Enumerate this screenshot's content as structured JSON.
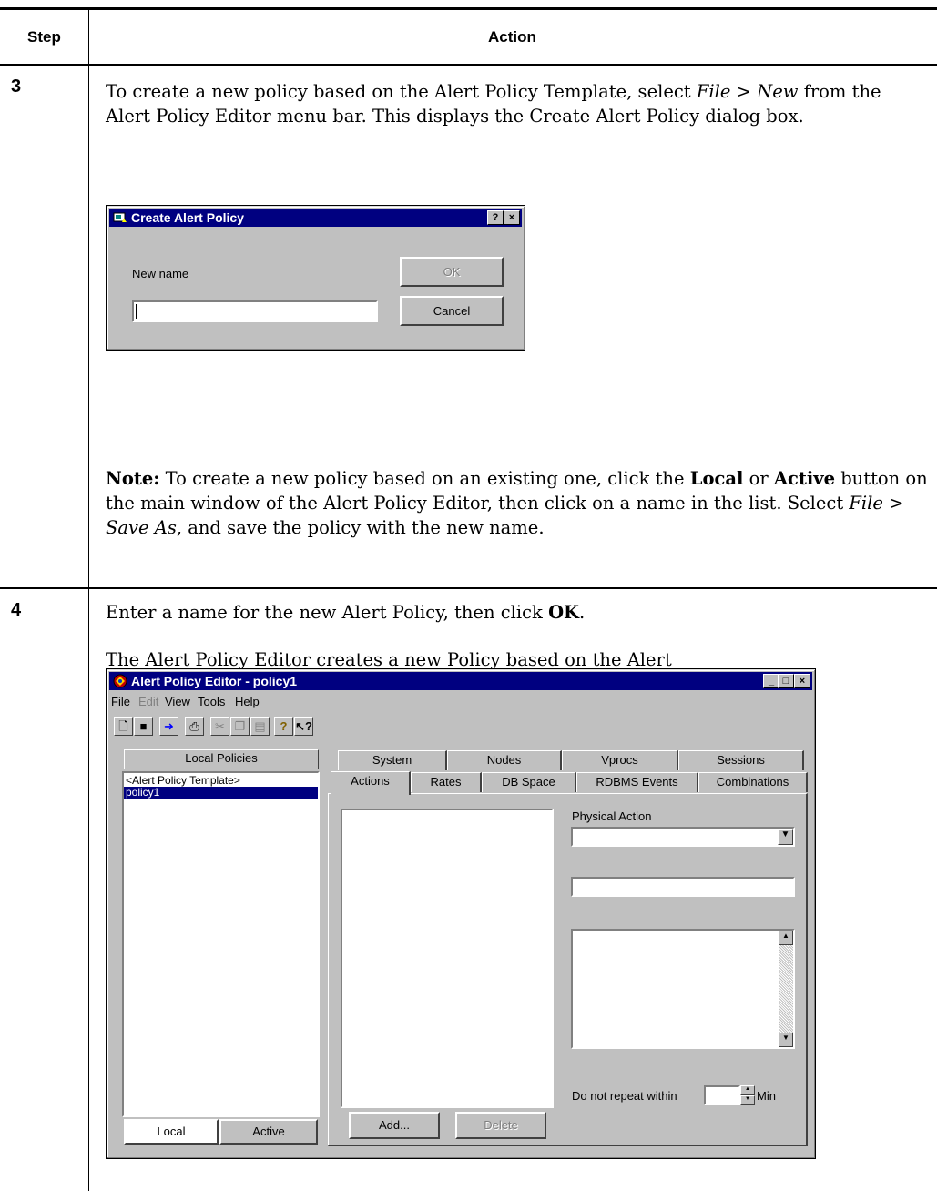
{
  "table": {
    "col_step": "Step",
    "col_action": "Action"
  },
  "step3": {
    "number": "3",
    "intro": "To create a new policy based on the Alert Policy Template, select <i>File</i> &gt; <i>New</i> from the Alert Policy Editor menu bar. This displays the Create Alert Policy dialog box.",
    "note": "<b>Note:</b> To create a new policy based on an existing one, click the <b>Local</b> or <b>Active</b> button on the main window of the Alert Policy Editor, then click on a name in the list. Select <i>File</i> &gt; <i>Save As</i>, and save the policy with the new name.",
    "dialog": {
      "title": "Create Alert Policy",
      "help_btn": "?",
      "close_btn": "×",
      "new_name_label": "New name",
      "new_name_value": "",
      "ok_label": "OK",
      "cancel_label": "Cancel"
    }
  },
  "step4": {
    "number": "4",
    "line1": "Enter a name for the new Alert Policy, then click <b>OK</b>.",
    "line2": "The Alert Policy Editor creates a new Policy based on the Alert Policy Template.",
    "editor": {
      "title": "Alert Policy Editor - policy1",
      "menu": [
        "File",
        "Edit",
        "View",
        "Tools",
        "Help"
      ],
      "local_policies_header": "Local Policies",
      "policies": [
        "<Alert Policy Template>",
        "policy1"
      ],
      "selected_policy": "policy1",
      "tabs_back": [
        "System",
        "Nodes",
        "Vprocs",
        "Sessions"
      ],
      "tabs_front": [
        "Actions",
        "Rates",
        "DB Space",
        "RDBMS Events",
        "Combinations"
      ],
      "physical_action_label": "Physical Action",
      "do_not_repeat_label": "Do not repeat within",
      "min_label": "Min",
      "add_label": "Add...",
      "delete_label": "Delete",
      "local_btn": "Local",
      "active_btn": "Active"
    }
  }
}
